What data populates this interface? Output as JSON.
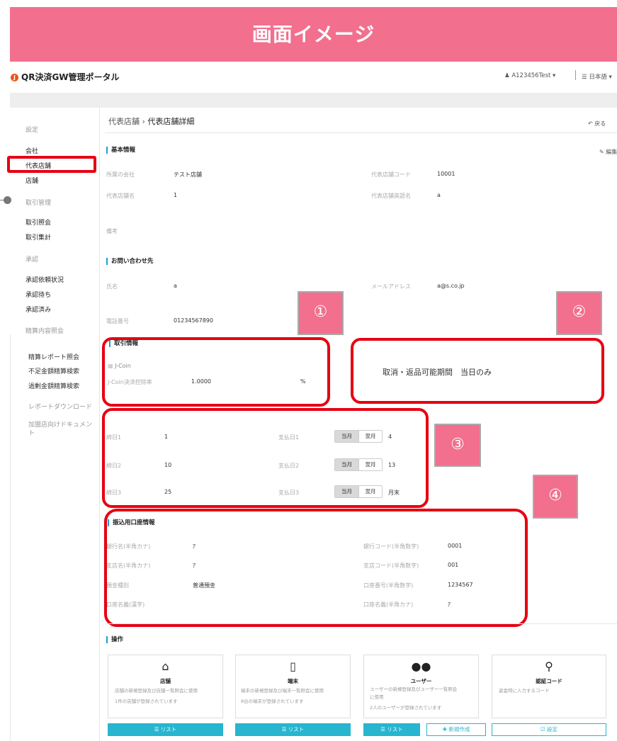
{
  "banner": {
    "title": "画面イメージ"
  },
  "header": {
    "app_title": "QR決済GW管理ポータル",
    "user": "A123456Test ▾",
    "language": "日本語 ▾"
  },
  "sidebar": {
    "settings_heading": "設定",
    "company": "会社",
    "rep_store": "代表店舗",
    "store": "店舗",
    "txn_heading": "取引管理",
    "txn_inquiry": "取引照会",
    "txn_summary": "取引集計",
    "approval_heading": "承認",
    "approval_status": "承認依頼状況",
    "approval_waiting": "承認待ち",
    "approval_done": "承認済み",
    "settlement_heading": "精算内容照会",
    "settlement_report": "精算レポート照会",
    "shortage_search": "不足金額精算検索",
    "surplus_search": "過剰金額精算検索",
    "report_download": "レポートダウンロード",
    "merchant_docs_1": "加盟店向けドキュメン",
    "merchant_docs_2": "ト"
  },
  "breadcrumb": {
    "parent": "代表店舗",
    "sep": "›",
    "current": "代表店舗詳細"
  },
  "back_label": "戻る",
  "basic_info": {
    "heading": "基本情報",
    "edit_label": "編集",
    "company_label": "所属の会社",
    "company_value": "テスト店舗",
    "code_label": "代表店舗コード",
    "code_value": "10001",
    "name_label": "代表店舗名",
    "name_value": "1",
    "name_en_label": "代表店舗英語名",
    "name_en_value": "a",
    "note_label": "備考"
  },
  "contact": {
    "heading": "お問い合わせ先",
    "person_label": "氏名",
    "person_value": "a",
    "email_label": "メールアドレス",
    "email_value": "a@s.co.jp",
    "phone_label": "電話番号",
    "phone_value": "01234567890"
  },
  "badges": {
    "b1": "①",
    "b2": "②",
    "b3": "③",
    "b4": "④"
  },
  "txn_info": {
    "heading": "取引情報",
    "jcoin": "J-Coin",
    "rate_label": "J-Coin決済控除率",
    "rate_value": "1.0000",
    "rate_unit": "%"
  },
  "cancel_period": {
    "text": "取消・返品可能期間　当日のみ"
  },
  "closing": {
    "rows": [
      {
        "close_label": "締日1",
        "close_value": "1",
        "pay_label": "支払日1",
        "seg_this": "当月",
        "seg_next": "翌月",
        "pay_value": "4"
      },
      {
        "close_label": "締日2",
        "close_value": "10",
        "pay_label": "支払日2",
        "seg_this": "当月",
        "seg_next": "翌月",
        "pay_value": "13"
      },
      {
        "close_label": "締日3",
        "close_value": "25",
        "pay_label": "支払日3",
        "seg_this": "当月",
        "seg_next": "翌月",
        "pay_value": "月末"
      }
    ]
  },
  "bank": {
    "heading": "振込用口座情報",
    "bank_name_label": "銀行名(半角カナ)",
    "bank_name_value": "ｱ",
    "bank_code_label": "銀行コード(半角数字)",
    "bank_code_value": "0001",
    "branch_name_label": "支店名(半角カナ)",
    "branch_name_value": "ｱ",
    "branch_code_label": "支店コード(半角数字)",
    "branch_code_value": "001",
    "type_label": "預金種別",
    "type_value": "普通預金",
    "account_no_label": "口座番号(半角数字)",
    "account_no_value": "1234567",
    "holder_kanji_label": "口座名義(漢字)",
    "holder_kana_label": "口座名義(半角カナ)",
    "holder_kana_value": "ｱ"
  },
  "operations": {
    "heading": "操作",
    "cards": [
      {
        "title": "店舗",
        "desc1": "店舗の新規登録及び店舗一覧照会に使用",
        "desc2": "1件の店舗が登録されています",
        "btn": "☰ リスト"
      },
      {
        "title": "端末",
        "desc1": "端末の新規登録及び端末一覧照会に使用",
        "desc2": "8台の端末が登録されています",
        "btn": "☰ リスト"
      },
      {
        "title": "ユーザー",
        "desc1": "ユーザーの新規登録及びユーザー一覧照会",
        "desc1b": "に使用",
        "desc2": "2人のユーザーが登録されています",
        "btn": "☰ リスト",
        "btn2": "✚ 新規作成"
      },
      {
        "title": "認証コード",
        "desc1": "返金時に入力するコード",
        "btn": "☑ 設定"
      }
    ]
  }
}
